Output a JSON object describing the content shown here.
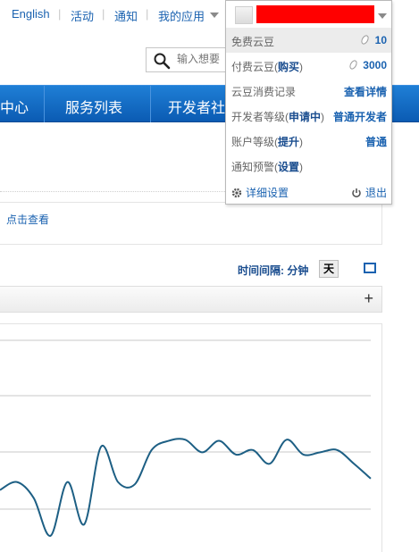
{
  "topnav": {
    "english": "English",
    "activity": "活动",
    "notice": "通知",
    "my_apps": "我的应用",
    "separator": "|"
  },
  "search": {
    "placeholder": "输入想要"
  },
  "mainmenu": {
    "item1": "中心",
    "item2": "服务列表",
    "item3": "开发者社"
  },
  "notice_link": "点击查看",
  "chart_controls": {
    "interval_label": "时间间隔: 分钟",
    "interval_value": "天"
  },
  "panel": {
    "expand": "+"
  },
  "user_menu": {
    "rows": [
      {
        "label": "免费云豆",
        "value": "10",
        "icon": "bean-icon",
        "highlighted": true
      },
      {
        "label": "付费云豆(",
        "action": "购买",
        "suffix": ")",
        "value": "3000",
        "icon": "bean-icon"
      },
      {
        "label": "云豆消费记录",
        "value": "查看详情"
      },
      {
        "label": "开发者等级(",
        "action": "申请中",
        "suffix": ")",
        "value": "普通开发者"
      },
      {
        "label": "账户等级(",
        "action": "提升",
        "suffix": ")",
        "value": "普通"
      },
      {
        "label": "通知预警(",
        "action": "设置",
        "suffix": ")",
        "value": ""
      }
    ],
    "settings": "详细设置",
    "logout": "退出"
  },
  "colors": {
    "brand_blue": "#0b5bb3",
    "link_blue": "#1a62b0",
    "chart_line": "#1d5f84",
    "redacted": "#ff0000"
  },
  "chart_data": {
    "type": "line",
    "title": "",
    "xlabel": "",
    "ylabel": "",
    "grid": true,
    "series": [
      {
        "values": [
          0.55,
          0.62,
          0.48,
          0.15,
          0.62,
          0.25,
          0.93,
          0.62,
          0.6,
          0.9,
          0.98,
          0.99,
          0.88,
          0.98,
          0.86,
          0.9,
          0.78,
          0.99,
          0.86,
          0.88,
          0.9,
          0.78,
          0.65
        ]
      }
    ]
  }
}
